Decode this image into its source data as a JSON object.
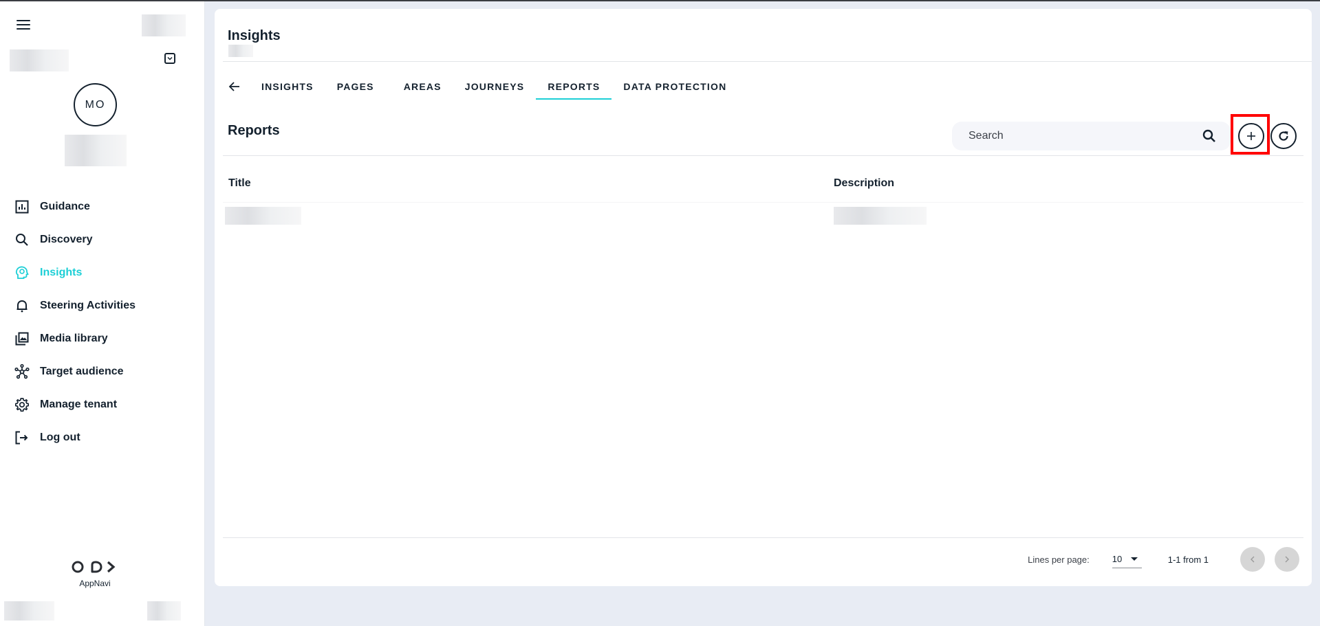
{
  "sidebar": {
    "avatar_initials": "MO",
    "items": [
      {
        "label": "Guidance",
        "icon": "chart-box-icon",
        "active": false
      },
      {
        "label": "Discovery",
        "icon": "search-icon",
        "active": false
      },
      {
        "label": "Insights",
        "icon": "head-lightbulb-icon",
        "active": true
      },
      {
        "label": "Steering Activities",
        "icon": "bell-icon",
        "active": false
      },
      {
        "label": "Media library",
        "icon": "image-library-icon",
        "active": false
      },
      {
        "label": "Target audience",
        "icon": "network-icon",
        "active": false
      },
      {
        "label": "Manage tenant",
        "icon": "gear-icon",
        "active": false
      },
      {
        "label": "Log out",
        "icon": "logout-icon",
        "active": false
      }
    ],
    "logo_text": "AppNavi"
  },
  "header": {
    "title": "Insights"
  },
  "tabs": [
    {
      "label": "INSIGHTS",
      "active": false
    },
    {
      "label": "PAGES",
      "active": false
    },
    {
      "label": "AREAS",
      "active": false
    },
    {
      "label": "JOURNEYS",
      "active": false
    },
    {
      "label": "REPORTS",
      "active": true
    },
    {
      "label": "DATA PROTECTION",
      "active": false
    }
  ],
  "reports": {
    "title": "Reports",
    "search_placeholder": "Search",
    "columns": [
      "Title",
      "Description"
    ]
  },
  "pagination": {
    "lines_per_page_label": "Lines per page:",
    "lines_per_page_value": "10",
    "range_text": "1-1 from 1"
  },
  "colors": {
    "accent": "#1ccfd6",
    "text": "#14212e",
    "background": "#e8ecf4",
    "highlight": "#ff0000"
  }
}
